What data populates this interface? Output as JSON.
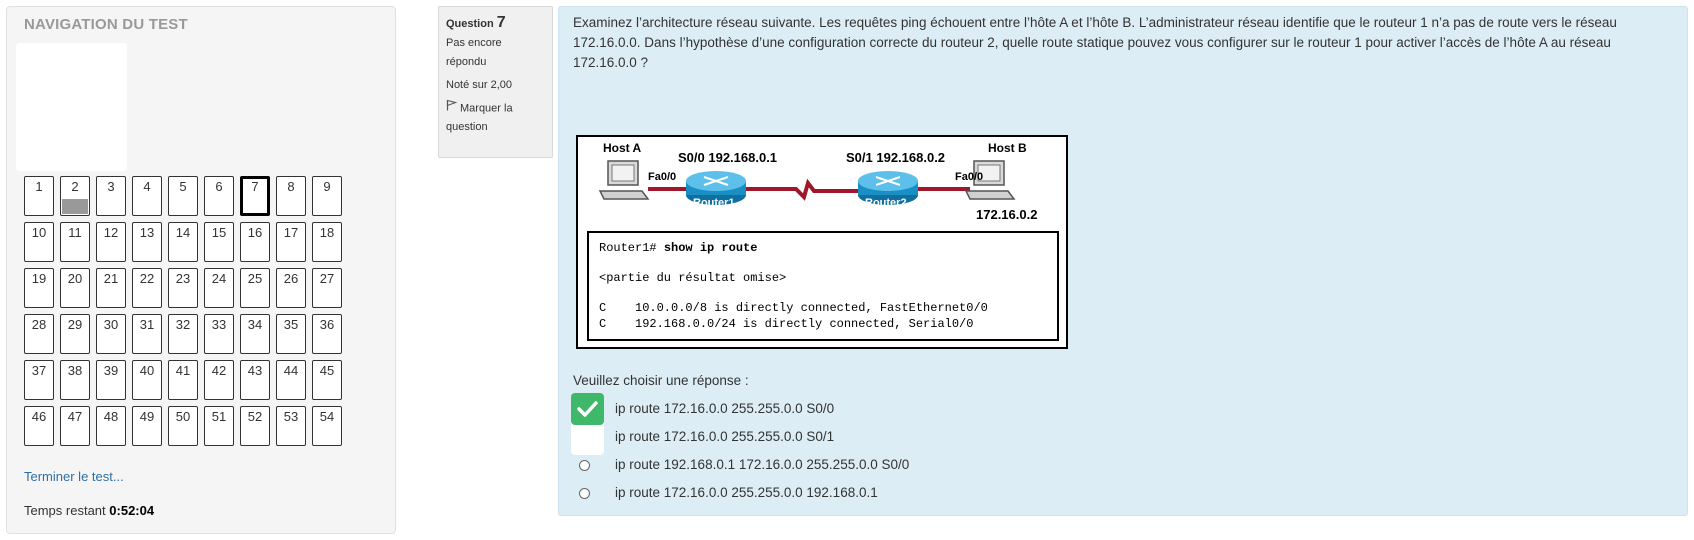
{
  "nav": {
    "title": "NAVIGATION DU TEST",
    "questions": [
      "1",
      "2",
      "3",
      "4",
      "5",
      "6",
      "7",
      "8",
      "9",
      "10",
      "11",
      "12",
      "13",
      "14",
      "15",
      "16",
      "17",
      "18",
      "19",
      "20",
      "21",
      "22",
      "23",
      "24",
      "25",
      "26",
      "27",
      "28",
      "29",
      "30",
      "31",
      "32",
      "33",
      "34",
      "35",
      "36",
      "37",
      "38",
      "39",
      "40",
      "41",
      "42",
      "43",
      "44",
      "45",
      "46",
      "47",
      "48",
      "49",
      "50",
      "51",
      "52",
      "53",
      "54"
    ],
    "current_question": "7",
    "answered_questions": [
      "2"
    ],
    "finish_link": "Terminer le test...",
    "timer_label": "Temps restant",
    "timer_value": "0:52:04"
  },
  "question_info": {
    "label": "Question",
    "number": "7",
    "status": "Pas encore répondu",
    "grade": "Noté sur 2,00",
    "flag_label": "Marquer la question"
  },
  "question": {
    "text": "Examinez l’architecture réseau suivante. Les requêtes ping échouent entre l’hôte A et l’hôte B. L’administrateur réseau identifie que le routeur 1 n’a pas de route vers le réseau 172.16.0.0. Dans l’hypothèse d’une configuration correcte du routeur 2, quelle route statique pouvez vous configurer sur le routeur 1 pour activer l’accès de l’hôte A au réseau 172.16.0.0 ?",
    "diagram": {
      "host_a": "Host A",
      "host_b": "Host B",
      "s00": "S0/0 192.168.0.1",
      "s01": "S0/1 192.168.0.2",
      "fa_left": "Fa0/0",
      "fa_right": "Fa0/0",
      "router1": "Router1",
      "router2": "Router2",
      "host_b_ip": "172.16.0.2",
      "cli_prompt": "Router1#",
      "cli_command": "show ip route",
      "cli_omitted": "<partie du résultat omise>",
      "cli_route1": "C    10.0.0.0/8 is directly connected, FastEthernet0/0",
      "cli_route2": "C    192.168.0.0/24 is directly connected, Serial0/0"
    },
    "prompt": "Veuillez choisir une réponse :",
    "answers": [
      "ip route 172.16.0.0 255.255.0.0 S0/0",
      "ip route 172.16.0.0 255.255.0.0 S0/1",
      "ip route 192.168.0.1 172.16.0.0 255.255.0.0 S0/0",
      "ip route 172.16.0.0 255.255.0.0 192.168.0.1"
    ],
    "selected_answer": "ip route 172.16.0.0 255.255.0.0 S0/0"
  },
  "colors": {
    "accent_link": "#2f6ea5",
    "content_bg": "#dcedf5",
    "check_green": "#3fb86a",
    "answered_fill": "#999999",
    "router_blue": "#1a8fc4",
    "serial_link": "#a0172b"
  }
}
